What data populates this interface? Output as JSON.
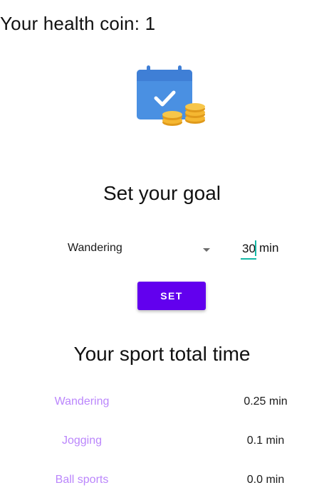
{
  "header": {
    "coin_label": "Your health coin:",
    "coin_value": "1"
  },
  "illustration": {
    "icon": "calendar-coins-icon",
    "colors": {
      "calendar": "#4a90e2",
      "coin": "#f5b731"
    }
  },
  "goal": {
    "title": "Set your goal",
    "selected_activity": "Wandering",
    "minutes_value": "30",
    "unit": "min",
    "set_label": "SET"
  },
  "sport_totals": {
    "title": "Your sport total time",
    "rows": [
      {
        "name": "Wandering",
        "value": "0.25 min"
      },
      {
        "name": "Jogging",
        "value": "0.1 min"
      },
      {
        "name": "Ball sports",
        "value": "0.0 min"
      }
    ]
  },
  "colors": {
    "accent": "#6200ee",
    "label_purple": "#bb86fc",
    "input_underline": "#14b8a6"
  }
}
